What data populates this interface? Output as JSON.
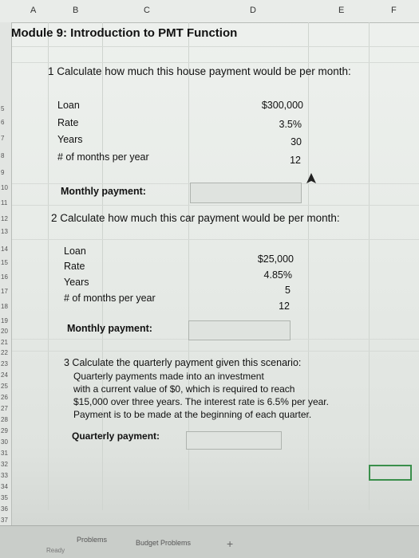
{
  "columns": [
    "A",
    "B",
    "C",
    "D",
    "E",
    "F"
  ],
  "rows": [
    "5",
    "6",
    "7",
    "8",
    "9",
    "10",
    "11",
    "12",
    "13",
    "14",
    "15",
    "16",
    "17",
    "18",
    "19",
    "20",
    "21",
    "22",
    "23",
    "24",
    "25",
    "26",
    "27",
    "28",
    "29",
    "30",
    "31",
    "32",
    "33",
    "34",
    "35",
    "36",
    "37"
  ],
  "title": "Module 9: Introduction to PMT Function",
  "problem1": {
    "question": "1 Calculate how much this house payment would be per month:",
    "items": [
      {
        "label": "Loan",
        "value": "$300,000"
      },
      {
        "label": "Rate",
        "value": "3.5%"
      },
      {
        "label": "Years",
        "value": "30"
      },
      {
        "label": "# of months per year",
        "value": "12"
      }
    ],
    "result_label": "Monthly payment:"
  },
  "problem2": {
    "question": "2 Calculate how much this car payment would be per month:",
    "items": [
      {
        "label": "Loan",
        "value": "$25,000"
      },
      {
        "label": "Rate",
        "value": "4.85%"
      },
      {
        "label": "Years",
        "value": "5"
      },
      {
        "label": "# of months per year",
        "value": "12"
      }
    ],
    "result_label": "Monthly payment:"
  },
  "problem3": {
    "lines": [
      "3 Calculate the quarterly payment given this scenario:",
      "Quarterly payments made into an investment",
      "with a current value of $0, which is required to reach",
      "$15,000 over three years. The interest rate is 6.5% per year.",
      "Payment is to be made at the beginning of each quarter."
    ],
    "result_label": "Quarterly payment:"
  },
  "sheet_tabs": [
    "Problems",
    "Budget Problems"
  ],
  "add_sheet": "+",
  "status": "Ready"
}
